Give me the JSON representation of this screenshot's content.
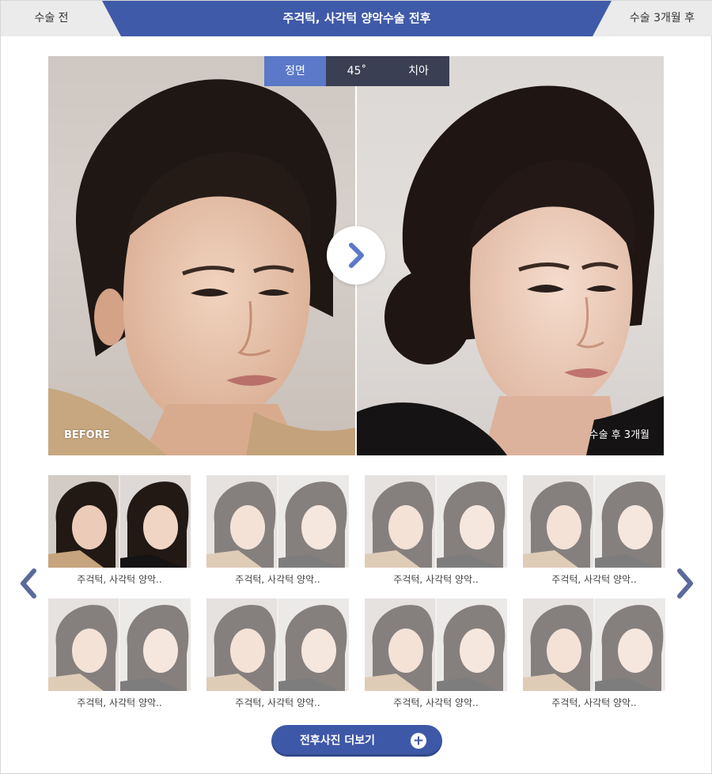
{
  "header": {
    "left_label": "수술 전",
    "title": "주걱턱, 사각턱 양악수술 전후",
    "right_label": "수술 3개월 후"
  },
  "view_tabs": [
    {
      "label": "정면",
      "active": true
    },
    {
      "label": "45˚",
      "active": false
    },
    {
      "label": "치아",
      "active": false
    }
  ],
  "compare": {
    "before_label": "BEFORE",
    "after_label": "수술 후 3개월"
  },
  "thumbnails": [
    {
      "caption": "주걱턱, 사각턱 양악..",
      "active": true
    },
    {
      "caption": "주걱턱, 사각턱 양악..",
      "active": false
    },
    {
      "caption": "주걱턱, 사각턱 양악..",
      "active": false
    },
    {
      "caption": "주걱턱, 사각턱 양악..",
      "active": false
    },
    {
      "caption": "주걱턱, 사각턱 양악..",
      "active": false
    },
    {
      "caption": "주걱턱, 사각턱 양악..",
      "active": false
    },
    {
      "caption": "주걱턱, 사각턱 양악..",
      "active": false
    },
    {
      "caption": "주걱턱, 사각턱 양악..",
      "active": false
    }
  ],
  "more_button": {
    "label": "전후사진 더보기",
    "icon": "plus-icon"
  },
  "colors": {
    "accent": "#3f5aa8",
    "tab_active": "#5b79c8",
    "tab_inactive": "#3b3f53",
    "arrow": "#5a6a9a"
  }
}
